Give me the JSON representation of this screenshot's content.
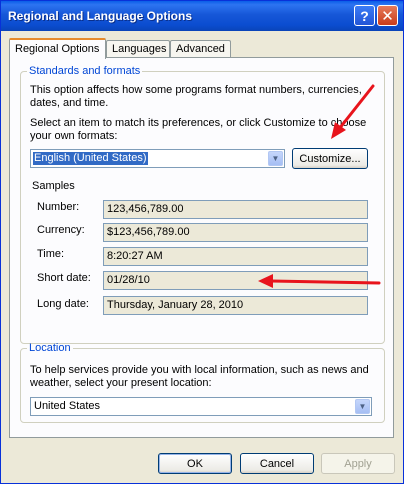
{
  "window": {
    "title": "Regional and Language Options",
    "help_glyph": "?",
    "close_glyph": "✕"
  },
  "tabs": [
    {
      "label": "Regional Options",
      "active": true
    },
    {
      "label": "Languages",
      "active": false
    },
    {
      "label": "Advanced",
      "active": false
    }
  ],
  "standards": {
    "group_title": "Standards and formats",
    "description": "This option affects how some programs format numbers, currencies, dates, and time.",
    "select_prompt": "Select an item to match its preferences, or click Customize to choose your own formats:",
    "format_value": "English (United States)",
    "customize_label": "Customize...",
    "samples_title": "Samples",
    "samples": [
      {
        "label": "Number:",
        "value": "123,456,789.00"
      },
      {
        "label": "Currency:",
        "value": "$123,456,789.00"
      },
      {
        "label": "Time:",
        "value": "8:20:27 AM"
      },
      {
        "label": "Short date:",
        "value": "01/28/10"
      },
      {
        "label": "Long date:",
        "value": "Thursday, January 28, 2010"
      }
    ]
  },
  "location": {
    "group_title": "Location",
    "description": "To help services provide you with local information, such as news and weather, select your present location:",
    "value": "United States"
  },
  "footer": {
    "ok_label": "OK",
    "cancel_label": "Cancel",
    "apply_label": "Apply"
  },
  "annotations": {
    "arrow_color": "#e8141c"
  }
}
